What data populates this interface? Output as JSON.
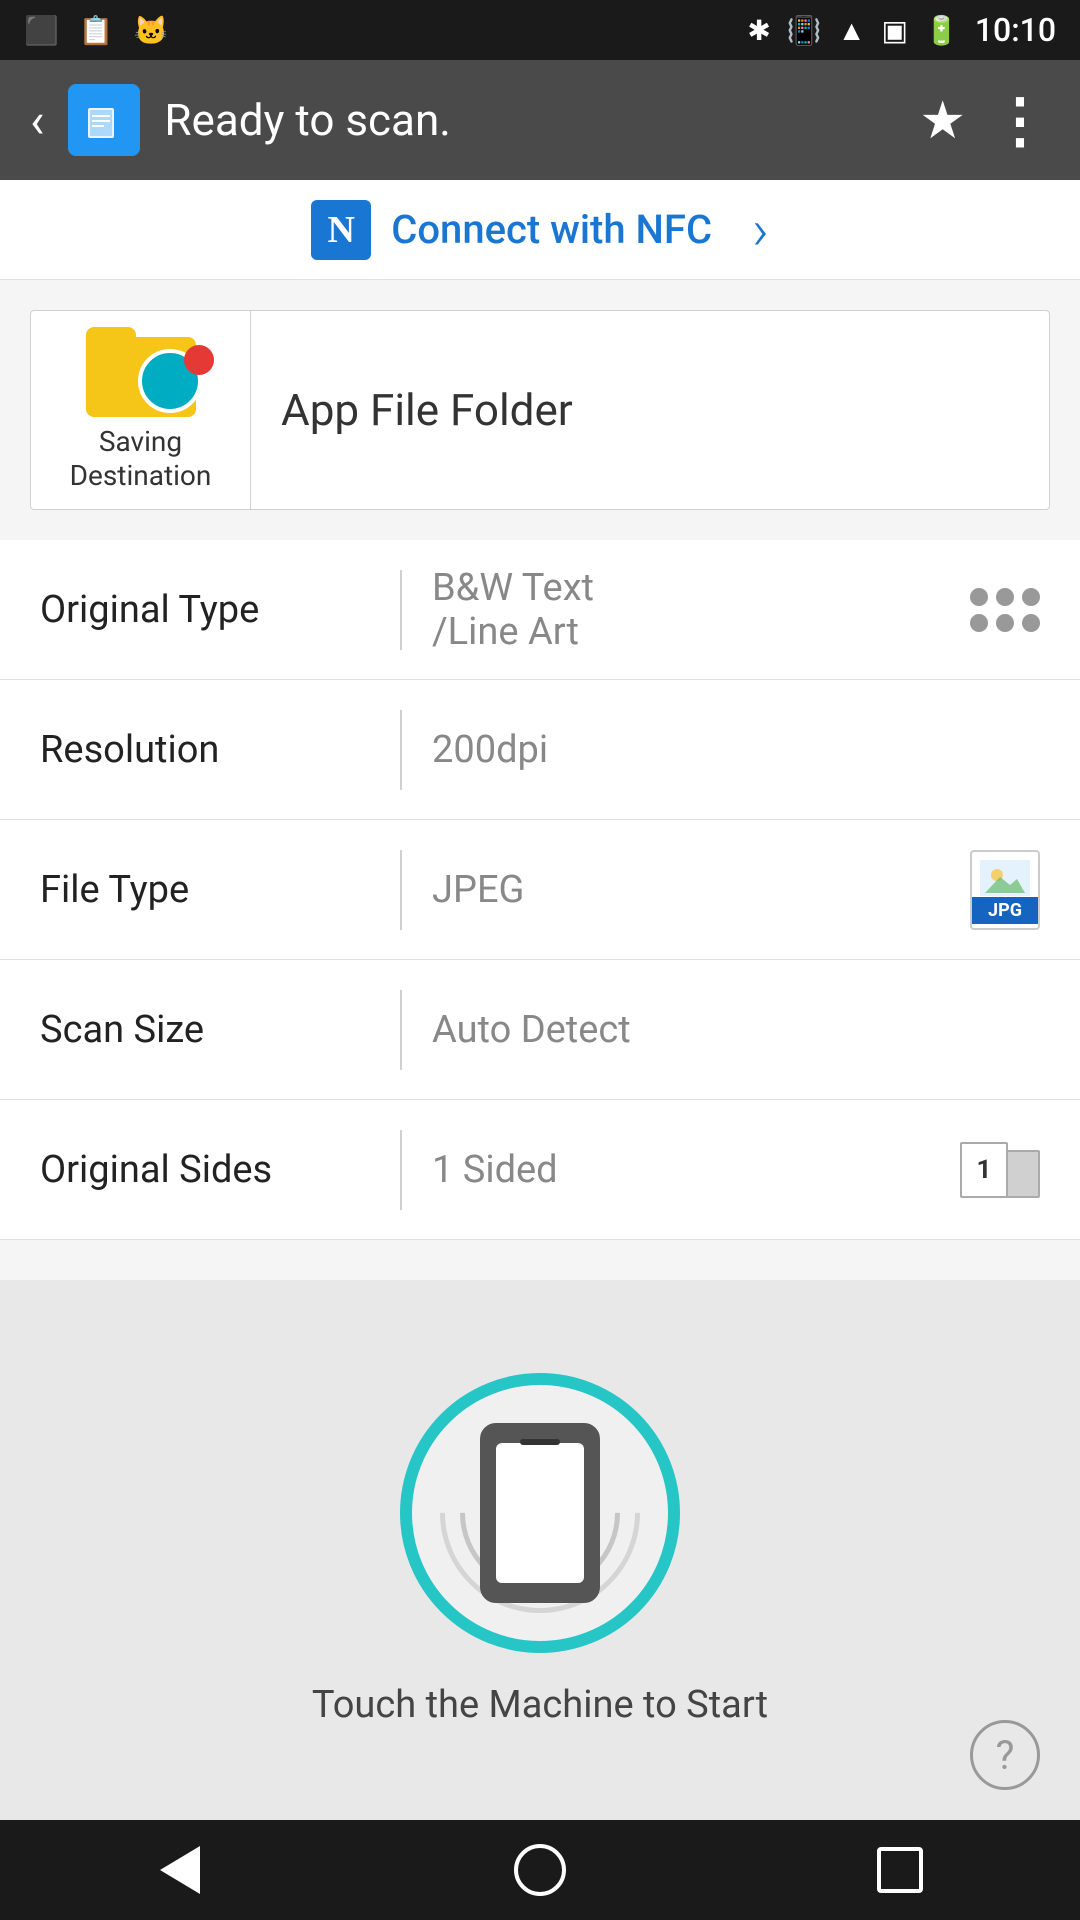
{
  "statusBar": {
    "time": "10:10"
  },
  "toolbar": {
    "title": "Ready to scan.",
    "starLabel": "★",
    "menuLabel": "⋮"
  },
  "nfc": {
    "iconLabel": "N",
    "text": "Connect with NFC",
    "arrowLabel": "›"
  },
  "savingDestination": {
    "label": "Saving\nDestination",
    "value": "App File Folder"
  },
  "settings": [
    {
      "label": "Original Type",
      "value": "B&W Text\n/Line Art",
      "iconType": "dots"
    },
    {
      "label": "Resolution",
      "value": "200dpi",
      "iconType": "none"
    },
    {
      "label": "File Type",
      "value": "JPEG",
      "iconType": "jpeg"
    },
    {
      "label": "Scan Size",
      "value": "Auto Detect",
      "iconType": "none"
    },
    {
      "label": "Original Sides",
      "value": "1 Sided",
      "iconType": "sided"
    }
  ],
  "scanArea": {
    "label": "Touch the Machine to Start",
    "helpLabel": "?"
  },
  "navigation": {
    "backLabel": "back",
    "homeLabel": "home",
    "recentLabel": "recent"
  }
}
